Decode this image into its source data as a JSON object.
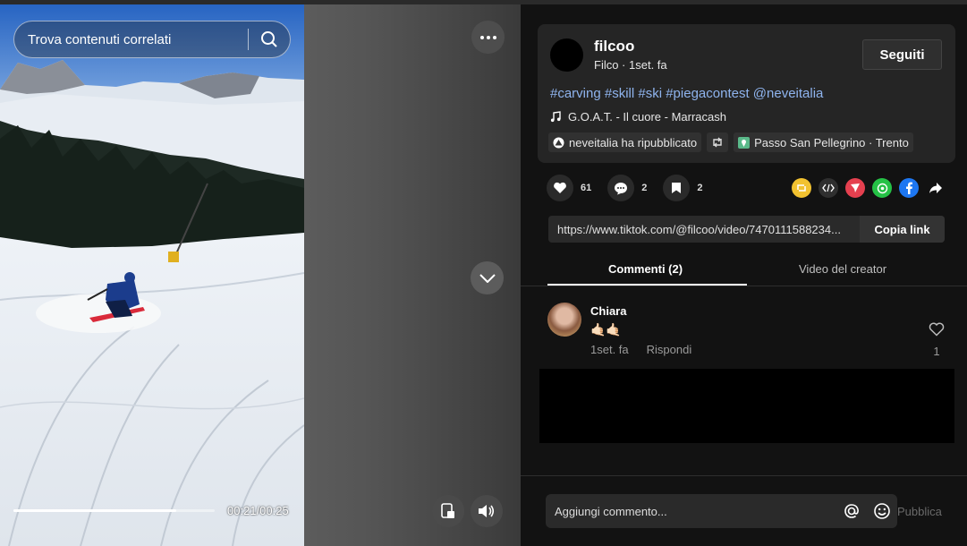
{
  "video": {
    "search_placeholder": "Trova contenuti correlati",
    "time": "00:21/00:25",
    "progress_fraction": 0.81
  },
  "post": {
    "username": "filcoo",
    "subline": "Filco · 1set. fa",
    "follow_label": "Seguiti",
    "hashtags": "#carving #skill #ski #piegacontest @neveitalia",
    "music": "G.O.A.T. - Il cuore - Marracash",
    "repost_chip": "neveitalia ha ripubblicato",
    "location_chip": "Passo San Pellegrino · Trento"
  },
  "actions": {
    "likes": "61",
    "comments": "2",
    "saves": "2"
  },
  "link": {
    "url": "https://www.tiktok.com/@filcoo/video/7470111588234...",
    "copy_label": "Copia link"
  },
  "tabs": {
    "comments": "Commenti (2)",
    "creator_videos": "Video del creator"
  },
  "comment": {
    "author": "Chiara",
    "text": "🤙🏻🤙🏻",
    "time": "1set. fa",
    "reply_label": "Rispondi",
    "like_count": "1"
  },
  "footer": {
    "input_placeholder": "Aggiungi commento...",
    "publish_label": "Pubblica"
  },
  "colors": {
    "hashtag": "#8fb4ee",
    "share_yellow": "#f2c230",
    "share_red": "#e5404f",
    "share_whatsapp": "#25c146",
    "share_facebook": "#1d77f2"
  }
}
